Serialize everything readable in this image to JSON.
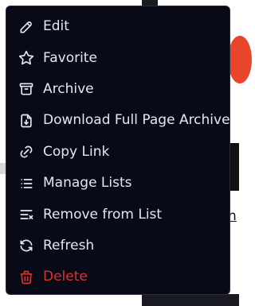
{
  "menu": {
    "items": [
      {
        "label": "Edit",
        "icon": "pencil-icon"
      },
      {
        "label": "Favorite",
        "icon": "star-icon"
      },
      {
        "label": "Archive",
        "icon": "archive-icon"
      },
      {
        "label": "Download Full Page Archive",
        "icon": "download-file-icon"
      },
      {
        "label": "Copy Link",
        "icon": "link-icon"
      },
      {
        "label": "Manage Lists",
        "icon": "list-icon"
      },
      {
        "label": "Remove from List",
        "icon": "list-remove-icon"
      },
      {
        "label": "Refresh",
        "icon": "refresh-icon"
      },
      {
        "label": "Delete",
        "icon": "trash-icon"
      }
    ]
  },
  "background": {
    "partial_text": "n"
  },
  "colors": {
    "menu_bg": "#090a17",
    "text": "#e6e7ee",
    "danger": "#e03131"
  }
}
